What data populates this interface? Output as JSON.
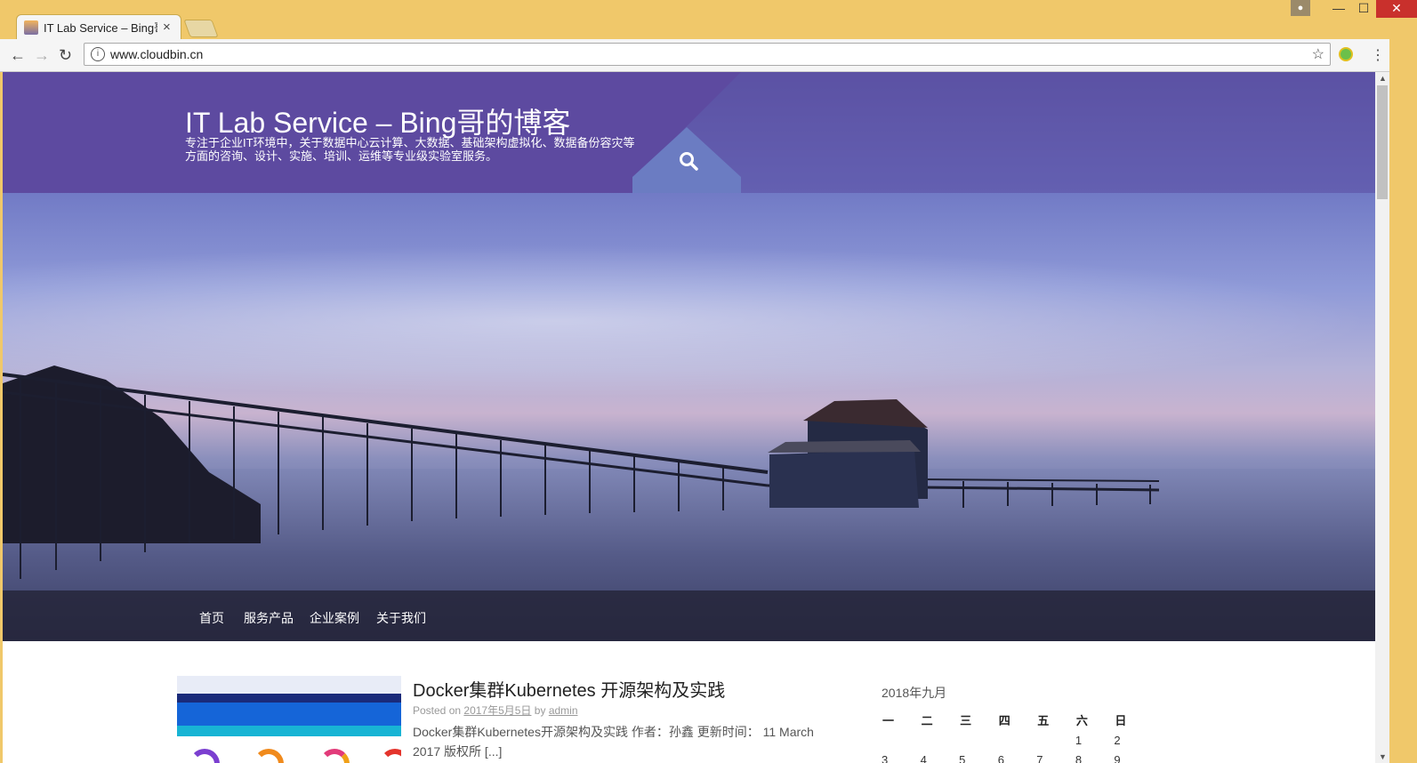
{
  "browser": {
    "tab_title": "IT Lab Service – Bing哥",
    "tab_close": "×",
    "url": "www.cloudbin.cn",
    "nav_back": "←",
    "nav_forward": "→",
    "nav_reload": "↻",
    "bookmark_star": "☆",
    "menu_dots": "⋮",
    "win_min": "—",
    "win_max": "☐",
    "win_close": "✕"
  },
  "site": {
    "title": "IT Lab Service – Bing哥的博客",
    "description": "专注于企业IT环境中，关于数据中心云计算、大数据、基础架构虚拟化、数据备份容灾等方面的咨询、设计、实施、培训、运维等专业级实验室服务。"
  },
  "nav": {
    "items": [
      "首页",
      "服务产品",
      "企业案例",
      "关于我们"
    ]
  },
  "post": {
    "title": "Docker集群Kubernetes 开源架构及实践",
    "posted_on": "Posted on",
    "date": "2017年5月5日",
    "by": "by",
    "author": "admin",
    "excerpt": "Docker集群Kubernetes开源架构及实践 作者：孙鑫 更新时间： 11 March 2017 版权所 [...]"
  },
  "calendar": {
    "caption": "2018年九月",
    "weekdays": [
      "一",
      "二",
      "三",
      "四",
      "五",
      "六",
      "日"
    ],
    "rows": [
      [
        "",
        "",
        "",
        "",
        "",
        "1",
        "2"
      ],
      [
        "3",
        "4",
        "5",
        "6",
        "7",
        "8",
        "9"
      ]
    ]
  },
  "colors": {
    "header_purple": "#5d4aa0",
    "search_tab": "#6b7cc2",
    "chrome_frame": "#f0c86a"
  }
}
